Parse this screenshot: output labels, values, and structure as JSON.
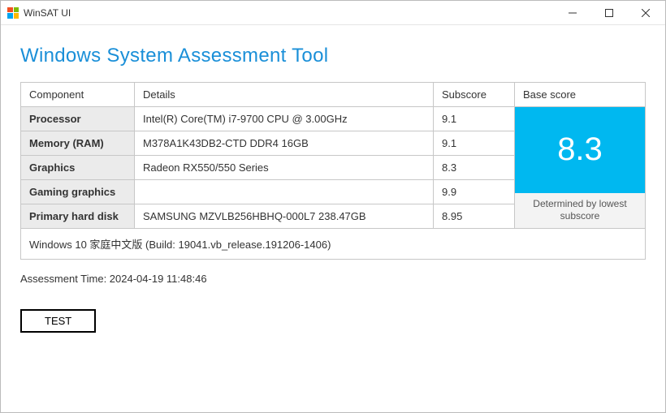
{
  "titlebar": {
    "title": "WinSAT UI"
  },
  "heading": "Windows System Assessment Tool",
  "headers": {
    "component": "Component",
    "details": "Details",
    "subscore": "Subscore",
    "base_score": "Base score"
  },
  "rows": [
    {
      "component": "Processor",
      "details": "Intel(R) Core(TM) i7-9700 CPU @ 3.00GHz",
      "subscore": "9.1"
    },
    {
      "component": "Memory (RAM)",
      "details": "M378A1K43DB2-CTD DDR4 16GB",
      "subscore": "9.1"
    },
    {
      "component": "Graphics",
      "details": "Radeon RX550/550 Series",
      "subscore": "8.3"
    },
    {
      "component": "Gaming graphics",
      "details": "",
      "subscore": "9.9"
    },
    {
      "component": "Primary hard disk",
      "details": "SAMSUNG MZVLB256HBHQ-000L7 238.47GB",
      "subscore": "8.95"
    }
  ],
  "base_score": {
    "value": "8.3",
    "caption": "Determined by lowest subscore"
  },
  "os_info": "Windows 10 家庭中文版 (Build: 19041.vb_release.191206-1406)",
  "assessment_time": "Assessment Time: 2024-04-19 11:48:46",
  "test_button": "TEST"
}
